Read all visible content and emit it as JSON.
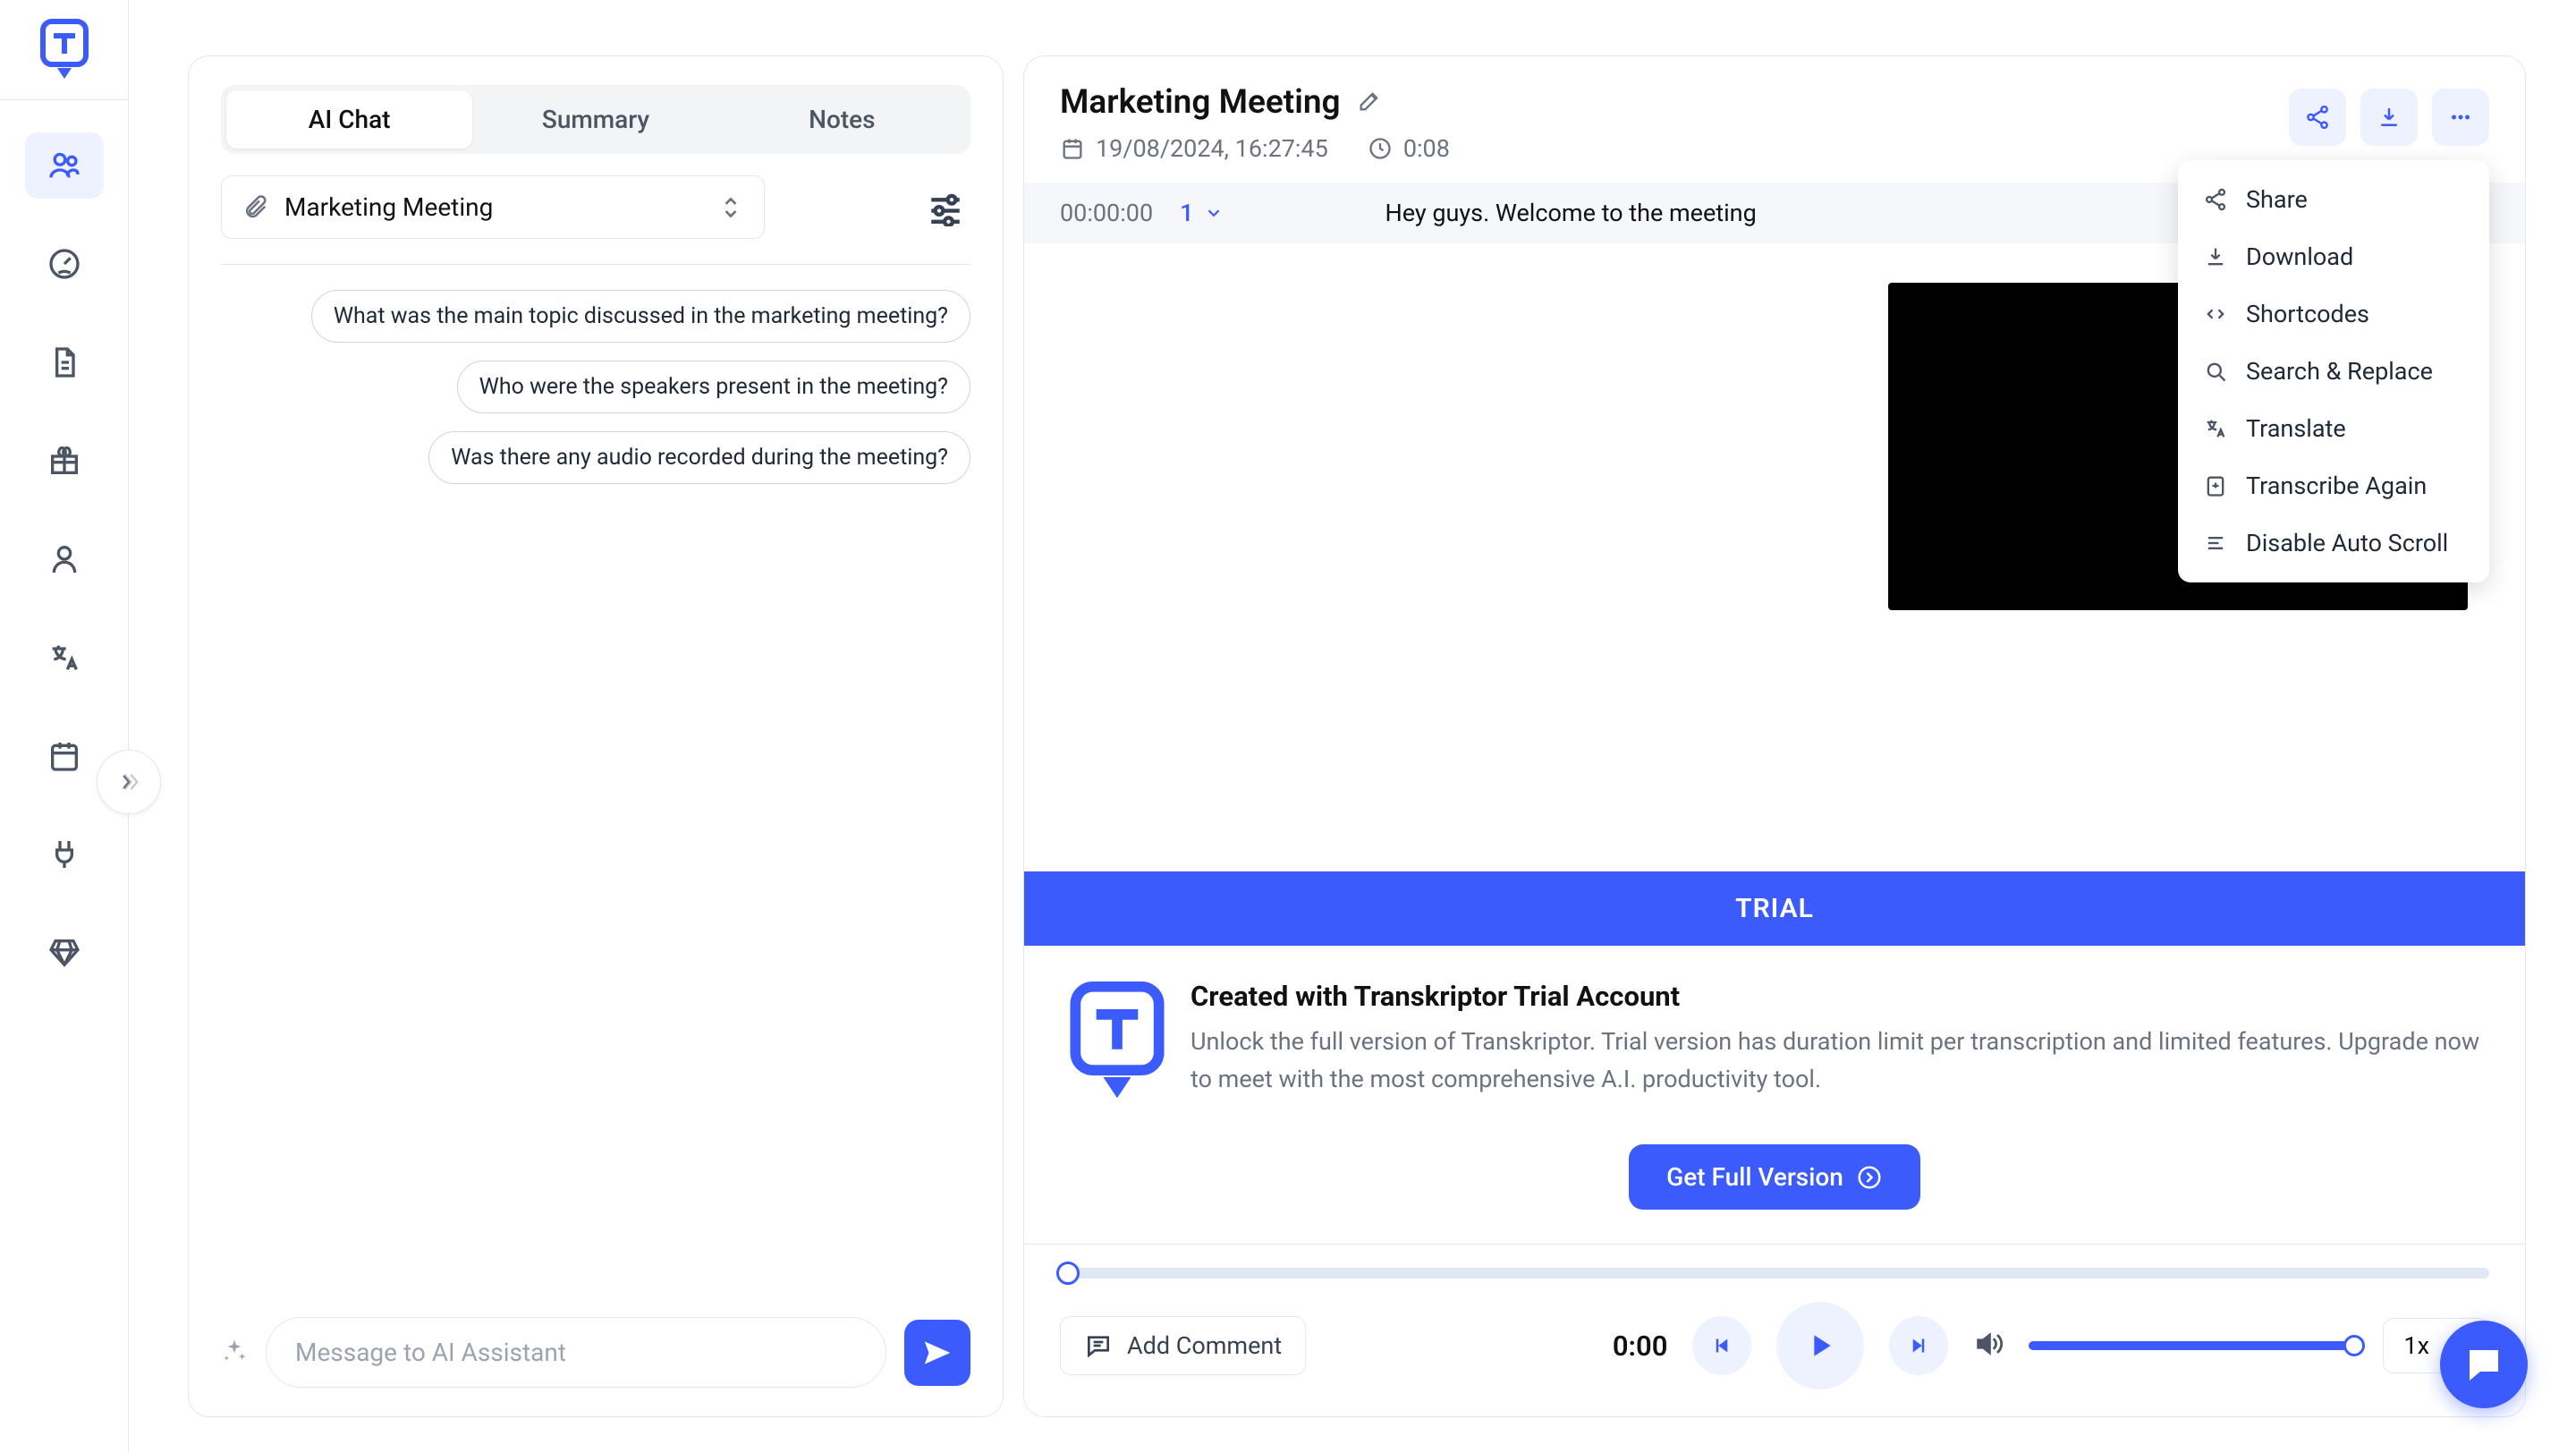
{
  "tabs": {
    "chat": "AI Chat",
    "summary": "Summary",
    "notes": "Notes"
  },
  "file_selector": {
    "name": "Marketing Meeting"
  },
  "suggestions": [
    "What was the main topic discussed in the marketing meeting?",
    "Who were the speakers present in the meeting?",
    "Was there any audio recorded during the meeting?"
  ],
  "chat_input": {
    "placeholder": "Message to AI Assistant"
  },
  "transcript": {
    "title": "Marketing Meeting",
    "date": "19/08/2024, 16:27:45",
    "duration": "0:08",
    "rows": [
      {
        "timestamp": "00:00:00",
        "speaker": "1",
        "text": "Hey guys. Welcome to the meeting"
      }
    ]
  },
  "dropdown": {
    "share": "Share",
    "download": "Download",
    "shortcodes": "Shortcodes",
    "search_replace": "Search & Replace",
    "translate": "Translate",
    "transcribe_again": "Transcribe Again",
    "disable_auto_scroll": "Disable Auto Scroll"
  },
  "trial": {
    "badge": "TRIAL",
    "heading": "Created with Transkriptor Trial Account",
    "body": "Unlock the full version of Transkriptor. Trial version has duration limit per transcription and limited features. Upgrade now to meet with the most comprehensive A.I. productivity tool.",
    "cta": "Get Full Version"
  },
  "player": {
    "comment": "Add Comment",
    "time": "0:00",
    "speed": "1x"
  }
}
